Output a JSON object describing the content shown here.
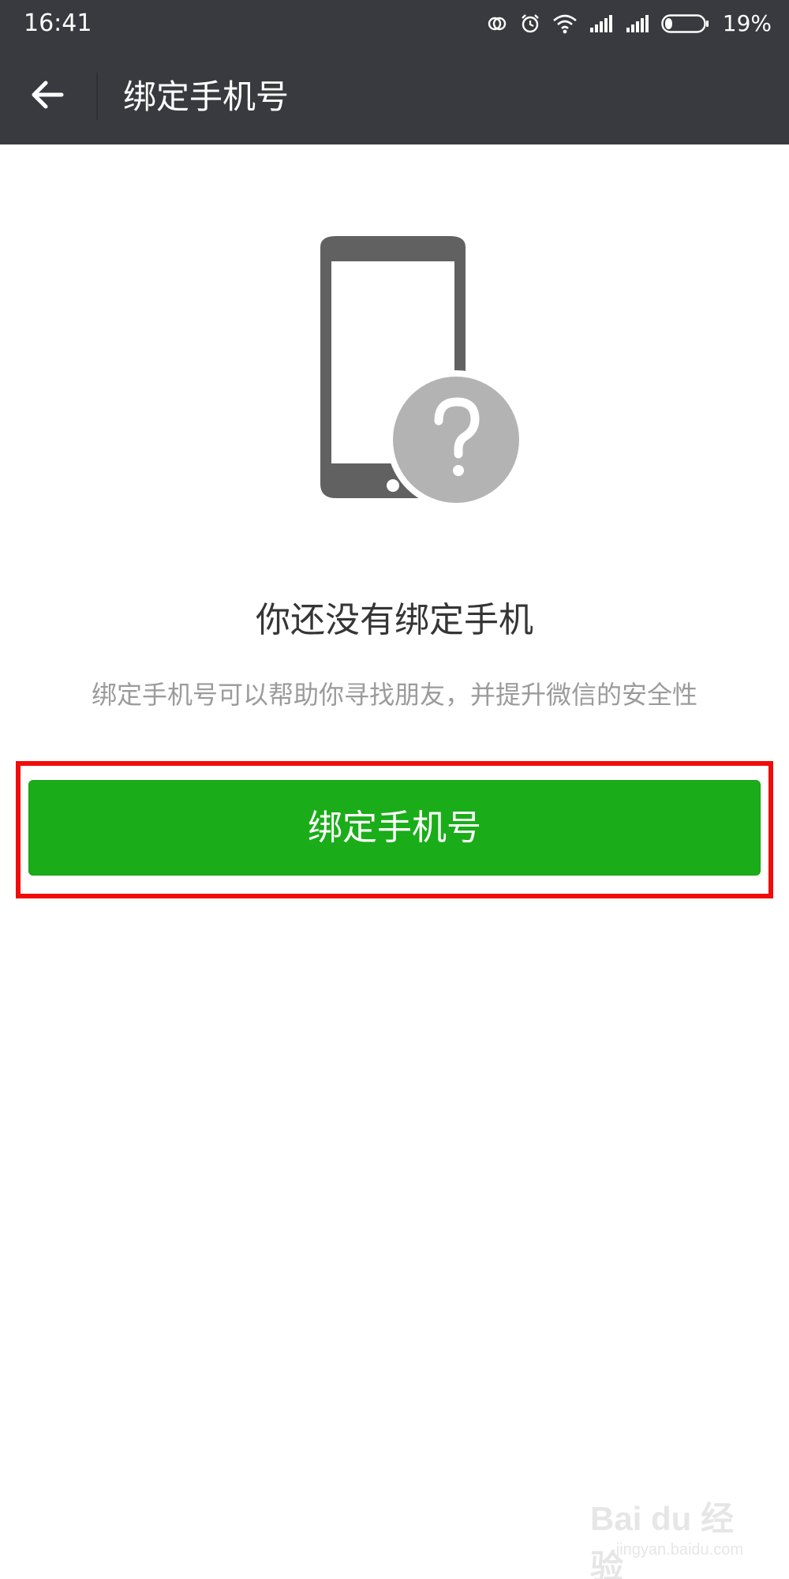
{
  "status_bar": {
    "time": "16:41",
    "battery_percent": "19%",
    "battery_level": 0.19,
    "icons": [
      "sync-icon",
      "alarm-icon",
      "wifi-icon",
      "signal-icon",
      "signal-icon",
      "battery-icon"
    ]
  },
  "header": {
    "title": "绑定手机号",
    "back_icon": "arrow-left-icon"
  },
  "empty_state": {
    "illustration_icon": "phone-question-icon",
    "title": "你还没有绑定手机",
    "description": "绑定手机号可以帮助你寻找朋友，并提升微信的安全性"
  },
  "action": {
    "bind_button_label": "绑定手机号"
  },
  "watermark": {
    "text": "Bai du 经验",
    "url": "jingyan.baidu.com"
  },
  "colors": {
    "header_bg": "#393a3f",
    "primary_green": "#1aad19",
    "highlight_red": "#f20b0b",
    "title_text": "#353535",
    "desc_text": "#9b9b9b"
  }
}
